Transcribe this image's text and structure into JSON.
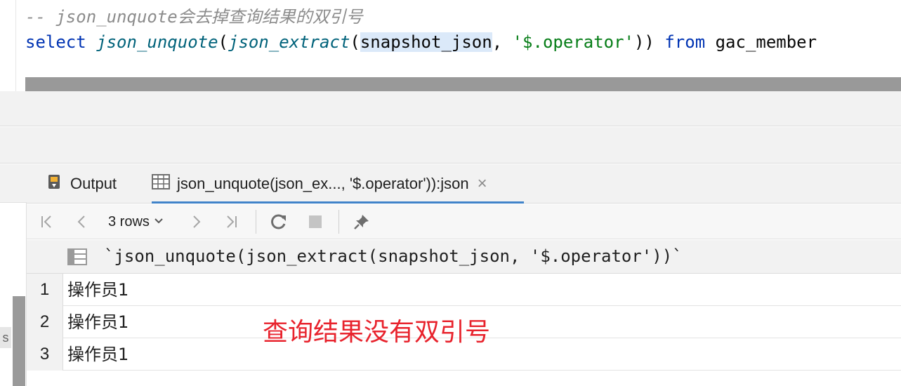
{
  "editor": {
    "comment": "-- json_unquote会去掉查询结果的双引号",
    "sql": {
      "kw_select": "select",
      "fn_unquote": "json_unquote",
      "p1": "(",
      "fn_extract": "json_extract",
      "p2": "(",
      "arg_column": "snapshot_json",
      "comma": ", ",
      "arg_path": "'$.operator'",
      "p3": ")) ",
      "kw_from": "from",
      "table": " gac_member"
    }
  },
  "tabs": [
    {
      "label": "Output",
      "icon": "output-icon"
    },
    {
      "label": "json_unquote(json_ex..., '$.operator')):json",
      "icon": "table-icon",
      "close": "×"
    }
  ],
  "toolbar": {
    "rows_label": "3 rows",
    "buttons": [
      "first-page-icon",
      "prev-page-icon",
      "next-page-icon",
      "last-page-icon",
      "refresh-icon",
      "stop-icon",
      "pin-icon"
    ]
  },
  "grid": {
    "column": "`json_unquote(json_extract(snapshot_json, '$.operator'))`",
    "rows": [
      {
        "num": "1",
        "value": "操作员1"
      },
      {
        "num": "2",
        "value": "操作员1"
      },
      {
        "num": "3",
        "value": "操作员1"
      }
    ]
  },
  "annotation": "查询结果没有双引号",
  "left_panel_letter": "s",
  "colors": {
    "keyword": "#0033b3",
    "string": "#067d17",
    "function": "#00627a",
    "annotation": "#e8232d",
    "tab_underline": "#4083c9"
  }
}
